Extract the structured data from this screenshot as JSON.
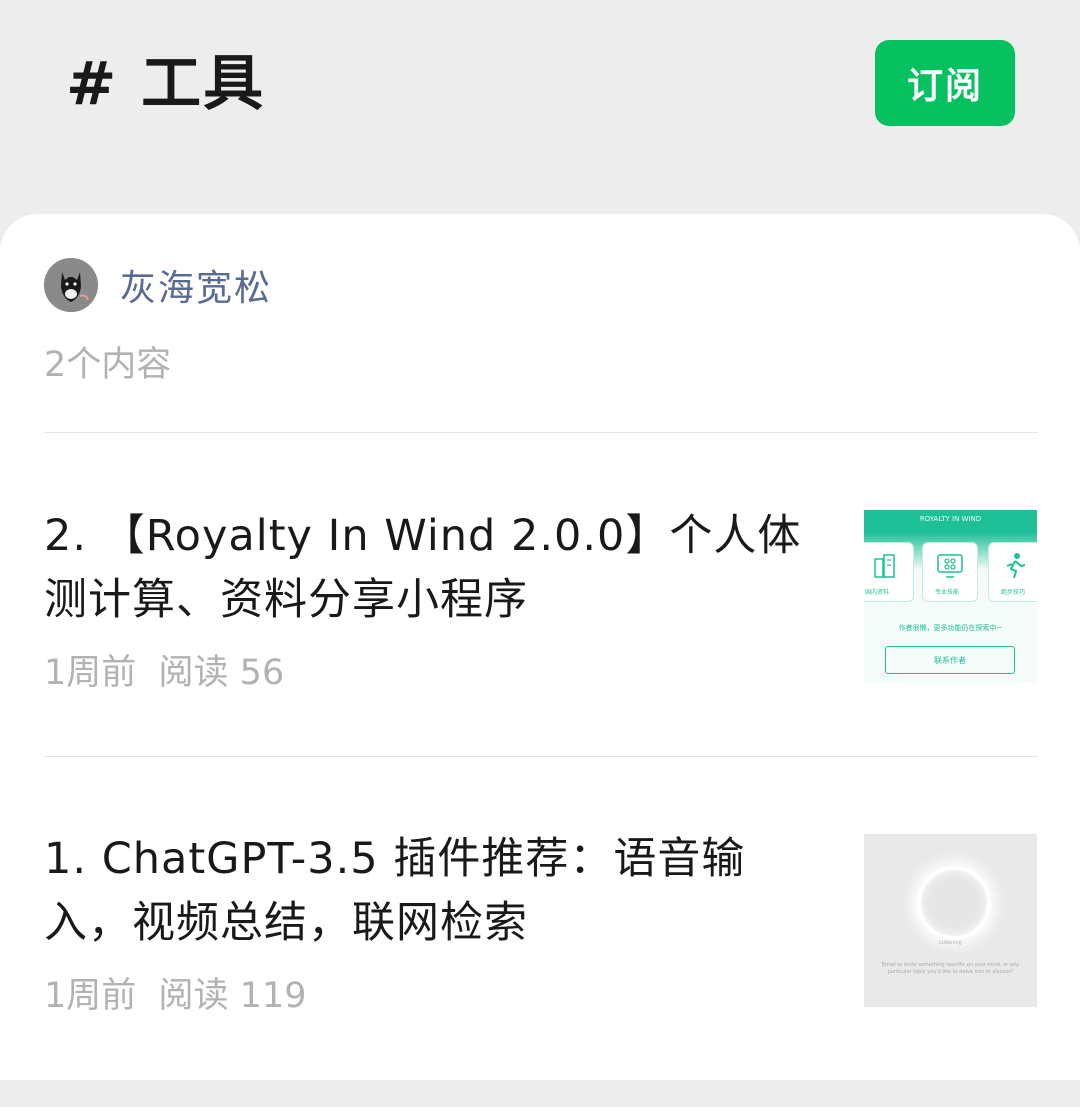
{
  "header": {
    "title": "# 工具",
    "subscribe_label": "订阅"
  },
  "author": {
    "name": "灰海宽松",
    "content_count": "2个内容"
  },
  "articles": [
    {
      "title": "2. 【Royalty In Wind 2.0.0】个人体测计算、资料分享小程序",
      "time": "1周前",
      "reads": "阅读 56",
      "thumbnail": {
        "app_name": "ROYALTY IN WIND",
        "tiles": [
          "国内资料",
          "专业技能",
          "跑步技巧"
        ],
        "notice": "作者很懒，更多功能仍在探索中~",
        "button": "联系作者"
      }
    },
    {
      "title": "1. ChatGPT-3.5 插件推荐：语音输入，视频总结，联网检索",
      "time": "1周前",
      "reads": "阅读 119",
      "thumbnail": {
        "status": "Listening",
        "prompt": "Email to Andy something specific on your mind, or any particular topic you'd like to delve into or discuss?"
      }
    }
  ],
  "colors": {
    "accent": "#07c160",
    "link": "#576b95",
    "muted": "#b2b2b2",
    "background": "#ededed",
    "thumb_teal": "#1fbf98"
  }
}
